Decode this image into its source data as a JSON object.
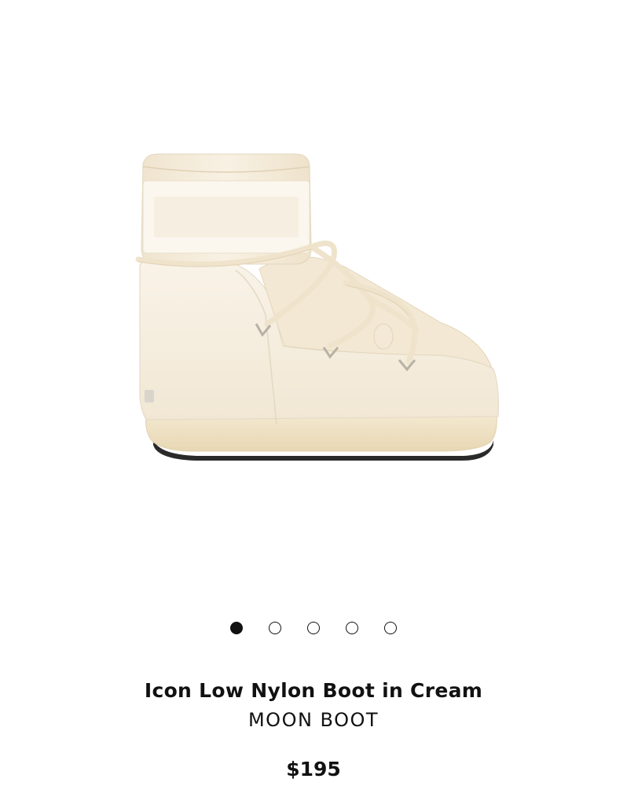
{
  "product": {
    "title": "Icon Low Nylon Boot in Cream",
    "brand": "MOON BOOT",
    "price": "$195",
    "image_subject": "cream-nylon-snow-boot",
    "colors": {
      "cream": "#f6efe2",
      "sole": "#efe3c7",
      "outsole": "#2a2a2a",
      "text": "#111111"
    }
  },
  "carousel": {
    "total": 5,
    "active_index": 0
  }
}
